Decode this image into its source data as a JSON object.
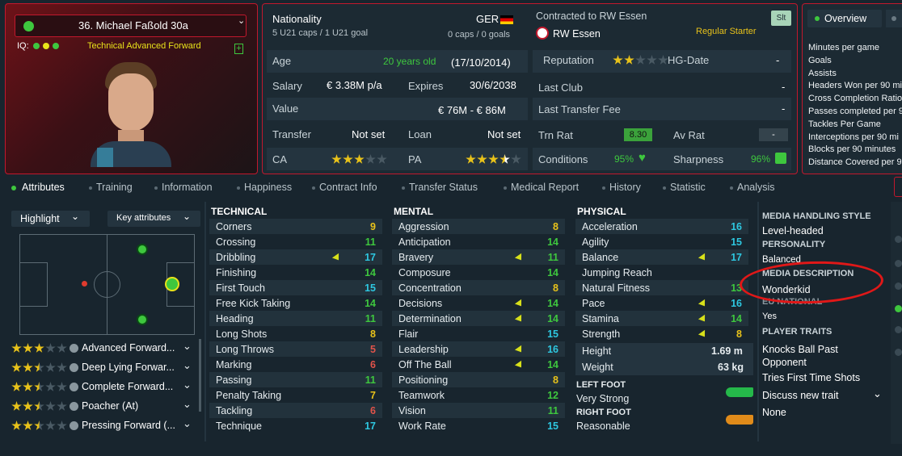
{
  "player": {
    "name": "36. Michael Faßold 30a",
    "iq_label": "IQ:",
    "role": "Technical Advanced Forward"
  },
  "nat": {
    "label": "Nationality",
    "code": "GER",
    "caps": "5 U21 caps / 1 U21 goal",
    "senior": "0 caps / 0 goals"
  },
  "club": {
    "contracted": "Contracted to RW Essen",
    "name": "RW Essen",
    "status": "Regular Starter",
    "slt": "Slt"
  },
  "info": {
    "age_l": "Age",
    "age_v": "20 years old",
    "dob": "(17/10/2014)",
    "rep_l": "Reputation",
    "rep_stars": 2,
    "hg_l": "HG-Date",
    "hg_v": "-",
    "sal_l": "Salary",
    "sal_v": "€ 3.38M p/a",
    "exp_l": "Expires",
    "exp_v": "30/6/2038",
    "last_l": "Last Club",
    "last_v": "-",
    "val_l": "Value",
    "val_v": "€ 76M - € 86M",
    "ltf_l": "Last Transfer Fee",
    "ltf_v": "-",
    "tr_l": "Transfer",
    "tr_v": "Not set",
    "loan_l": "Loan",
    "loan_v": "Not set",
    "trn_l": "Trn Rat",
    "trn_v": "8.30",
    "av_l": "Av Rat",
    "av_v": "-",
    "ca_l": "CA",
    "ca_stars": 3,
    "pa_l": "PA",
    "pa_stars": 3.5,
    "cond_l": "Conditions",
    "cond_v": "95%",
    "sharp_l": "Sharpness",
    "sharp_v": "96%"
  },
  "overview": {
    "tab": "Overview",
    "items": [
      "Minutes per game",
      "Goals",
      "Assists",
      "Headers Won per 90 mi",
      "Cross Completion Ratio",
      "Passes completed per 9",
      "Tackles Per Game",
      "Interceptions per 90 mi",
      "Blocks per 90 minutes",
      "Distance Covered per 9"
    ]
  },
  "tabs": [
    "Attributes",
    "Training",
    "Information",
    "Happiness",
    "Contract Info",
    "Transfer Status",
    "Medical Report",
    "History",
    "Statistic",
    "Analysis"
  ],
  "controls": {
    "highlight": "Highlight",
    "key": "Key attributes"
  },
  "roles": [
    {
      "name": "Advanced Forward...",
      "stars": 3
    },
    {
      "name": "Deep Lying Forwar...",
      "stars": 2.5
    },
    {
      "name": "Complete Forward...",
      "stars": 2.5
    },
    {
      "name": "Poacher (At)",
      "stars": 2.5
    },
    {
      "name": "Pressing Forward (...",
      "stars": 2.5
    }
  ],
  "technical": {
    "title": "TECHNICAL",
    "rows": [
      [
        "Corners",
        "9"
      ],
      [
        "Crossing",
        "11"
      ],
      [
        "Dribbling",
        "17"
      ],
      [
        "Finishing",
        "14"
      ],
      [
        "First Touch",
        "15"
      ],
      [
        "Free Kick Taking",
        "14"
      ],
      [
        "Heading",
        "11"
      ],
      [
        "Long Shots",
        "8"
      ],
      [
        "Long Throws",
        "5"
      ],
      [
        "Marking",
        "6"
      ],
      [
        "Passing",
        "11"
      ],
      [
        "Penalty Taking",
        "7"
      ],
      [
        "Tackling",
        "6"
      ],
      [
        "Technique",
        "17"
      ]
    ]
  },
  "mental": {
    "title": "MENTAL",
    "rows": [
      [
        "Aggression",
        "8"
      ],
      [
        "Anticipation",
        "14"
      ],
      [
        "Bravery",
        "11"
      ],
      [
        "Composure",
        "14"
      ],
      [
        "Concentration",
        "8"
      ],
      [
        "Decisions",
        "14"
      ],
      [
        "Determination",
        "14"
      ],
      [
        "Flair",
        "15"
      ],
      [
        "Leadership",
        "16"
      ],
      [
        "Off The Ball",
        "14"
      ],
      [
        "Positioning",
        "8"
      ],
      [
        "Teamwork",
        "12"
      ],
      [
        "Vision",
        "11"
      ],
      [
        "Work Rate",
        "15"
      ]
    ]
  },
  "physical": {
    "title": "PHYSICAL",
    "rows": [
      [
        "Acceleration",
        "16"
      ],
      [
        "Agility",
        "15"
      ],
      [
        "Balance",
        "17"
      ],
      [
        "Jumping Reach",
        ""
      ],
      [
        "Natural Fitness",
        "13"
      ],
      [
        "Pace",
        "16"
      ],
      [
        "Stamina",
        "14"
      ],
      [
        "Strength",
        "8"
      ]
    ],
    "height_l": "Height",
    "height_v": "1.69 m",
    "weight_l": "Weight",
    "weight_v": "63 kg",
    "lf_l": "LEFT FOOT",
    "lf_v": "Very Strong",
    "rf_l": "RIGHT FOOT",
    "rf_v": "Reasonable"
  },
  "side": {
    "mhs_h": "MEDIA HANDLING STYLE",
    "mhs_v": "Level-headed",
    "pers_h": "PERSONALITY",
    "pers_v": "Balanced",
    "md_h": "MEDIA DESCRIPTION",
    "md_v": "Wonderkid",
    "eu_h": "EU NATIONAL",
    "eu_v": "Yes",
    "pt_h": "PLAYER TRAITS",
    "traits": [
      "Knocks Ball Past",
      "Opponent",
      "Tries First Time Shots"
    ],
    "discuss": "Discuss new trait",
    "none": "None"
  },
  "colors": {
    "accent": "#c2182d",
    "green": "#3ec73e",
    "yellow": "#e8c21a",
    "cyan": "#2ec7e0"
  }
}
